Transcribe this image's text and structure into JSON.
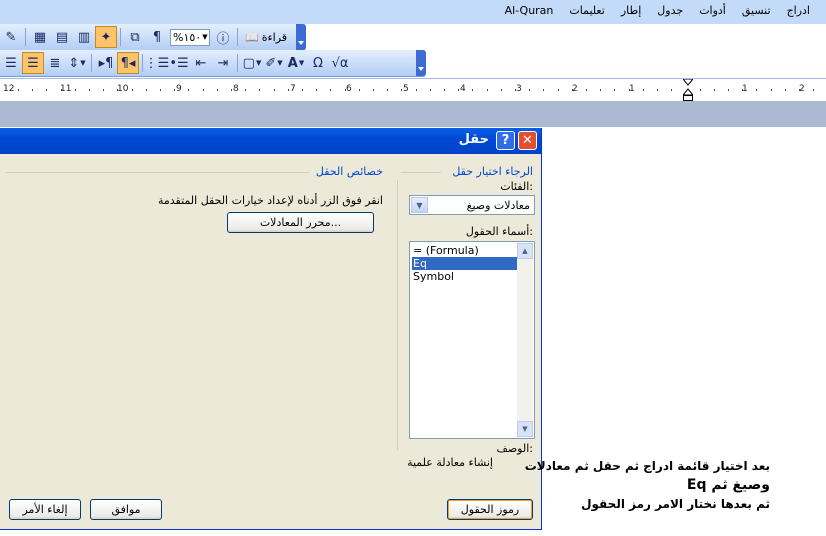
{
  "menu": {
    "items": [
      "ادراج",
      "تنسيق",
      "أدوات",
      "جدول",
      "إطار",
      "تعليمات",
      "Al-Quran"
    ]
  },
  "toolbar1": {
    "zoom_value": "%١٥٠",
    "read_label": "قراءة"
  },
  "ruler": {
    "labels": [
      "12",
      "11",
      "10",
      "9",
      "8",
      "7",
      "6",
      "5",
      "4",
      "3",
      "2",
      "1",
      "1",
      "2"
    ]
  },
  "dialog": {
    "title": "حقل",
    "choose_field_label": "الرجاء اختيار حقل",
    "categories_label": "الفئات:",
    "category_value": "معادلات وصيغ",
    "field_names_label": "أسماء الحقول:",
    "field_names": [
      "= (Formula)",
      "Eq",
      "Symbol"
    ],
    "selected_field": "Eq",
    "field_properties_label": "خصائص الحقل",
    "advanced_hint": "انقر فوق الزر أدناه لإعداد خيارات الحقل المتقدمة",
    "equation_editor_button": "محرر المعادلات...",
    "description_label": "الوصف:",
    "description_text": "إنشاء معادلة علمية",
    "field_codes_button": "رموز الحقول",
    "ok_button": "موافق",
    "cancel_button": "إلغاء الأمر"
  },
  "annotation": {
    "line1": "بعد اختيار قائمة ادراج ثم حقل ثم معادلات",
    "line2": "وصيغ ثم Eq",
    "line3": "ثم بعدها نختار الامر رمز الحقول"
  }
}
